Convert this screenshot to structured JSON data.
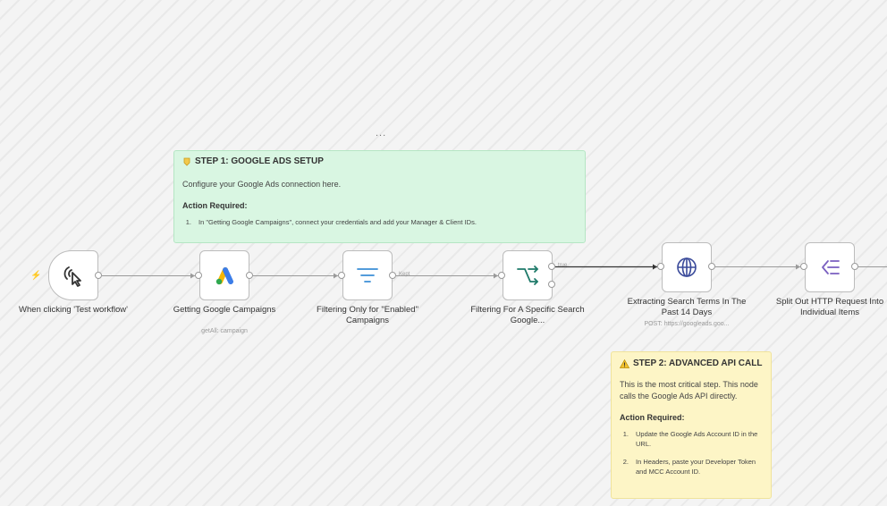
{
  "canvas": {
    "dots": "..."
  },
  "sticky_setup": {
    "title": "STEP 1: GOOGLE ADS SETUP",
    "body": "Configure your Google Ads connection here.",
    "action_heading": "Action Required:",
    "items": [
      {
        "num": "1.",
        "text": "In \"Getting Google Campaigns\", connect your credentials and add your Manager & Client IDs."
      }
    ],
    "color": "#d9f6e2"
  },
  "sticky_api": {
    "title": "STEP 2: ADVANCED API CALL",
    "body": "This is the most critical step. This node calls the Google Ads API directly.",
    "action_heading": "Action Required:",
    "items": [
      {
        "num": "1.",
        "text": "Update the Google Ads Account ID in the URL."
      },
      {
        "num": "2.",
        "text": "In Headers, paste your Developer Token and MCC Account ID."
      }
    ],
    "color": "#fdf5c6"
  },
  "nodes": [
    {
      "id": "trigger",
      "label": "When clicking 'Test workflow'",
      "icon": "cursor-click-icon"
    },
    {
      "id": "google_ads",
      "label": "Getting Google Campaigns",
      "sublabel": "getAll: campaign",
      "icon": "google-ads-icon"
    },
    {
      "id": "filter_enabled",
      "label": "Filtering Only for \"Enabled\" Campaigns",
      "icon": "filter-icon"
    },
    {
      "id": "filter_search",
      "label": "Filtering For A Specific Search Google...",
      "icon": "if-branch-icon"
    },
    {
      "id": "http_request",
      "label": "Extracting Search Terms In The Past 14 Days",
      "sublabel": "POST: https://googleads.goo...",
      "icon": "globe-icon"
    },
    {
      "id": "split_out",
      "label": "Split Out HTTP Request Into Individual Items",
      "icon": "split-out-icon"
    }
  ],
  "edges": {
    "kept_label": "Kept",
    "true_label": "true"
  },
  "colors": {
    "accent_trigger": "#f08a24",
    "filter_blue": "#3b8fd6",
    "if_green": "#1f7a6a",
    "globe_navy": "#3a4a9a",
    "split_purple": "#7a5fc0"
  }
}
